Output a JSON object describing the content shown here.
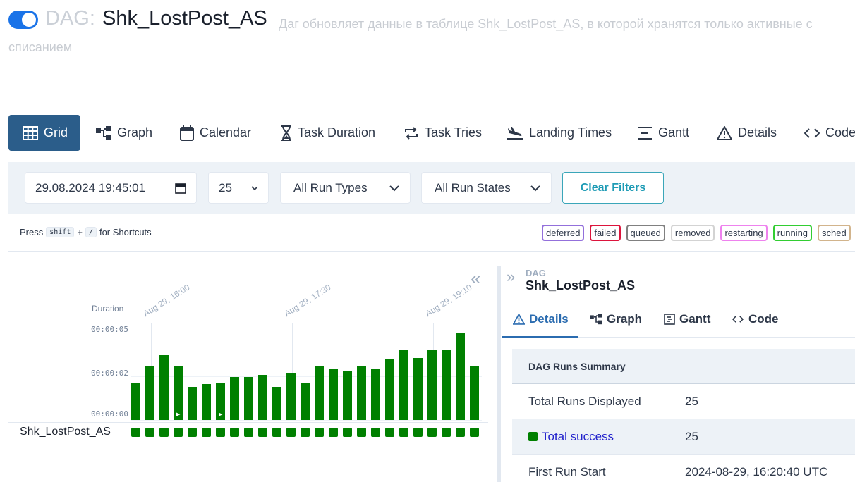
{
  "header": {
    "dag_prefix": "DAG:",
    "dag_name": "Shk_LostPost_AS",
    "description": "Даг обновляет данные в таблице Shk_LostPost_AS, в которой хранятся только активные с списанием",
    "toggle_on": true
  },
  "tabs": [
    {
      "label": "Grid",
      "icon": "grid-icon",
      "active": true
    },
    {
      "label": "Graph",
      "icon": "graph-icon"
    },
    {
      "label": "Calendar",
      "icon": "calendar-icon"
    },
    {
      "label": "Task Duration",
      "icon": "hourglass-icon"
    },
    {
      "label": "Task Tries",
      "icon": "repeat-icon"
    },
    {
      "label": "Landing Times",
      "icon": "plane-landing-icon"
    },
    {
      "label": "Gantt",
      "icon": "gantt-icon"
    },
    {
      "label": "Details",
      "icon": "warning-triangle-icon"
    },
    {
      "label": "Code",
      "icon": "code-icon"
    }
  ],
  "filters": {
    "datetime": "29.08.2024 19:45:01",
    "num_runs": "25",
    "run_types": "All Run Types",
    "run_states": "All Run States",
    "clear_label": "Clear Filters"
  },
  "shortcut": {
    "press": "Press",
    "key1": "shift",
    "plus": "+",
    "key2": "/",
    "suffix": "for Shortcuts"
  },
  "legend": [
    {
      "label": "deferred",
      "color": "#9370db"
    },
    {
      "label": "failed",
      "color": "#dc143c"
    },
    {
      "label": "queued",
      "color": "#808080"
    },
    {
      "label": "removed",
      "color": "#d3d3d3"
    },
    {
      "label": "restarting",
      "color": "#ee82ee"
    },
    {
      "label": "running",
      "color": "#32cd32"
    },
    {
      "label": "sched",
      "color": "#d2b48c"
    }
  ],
  "grid": {
    "duration_label": "Duration",
    "y_ticks": [
      "00:00:05",
      "00:00:02",
      "00:00:00"
    ],
    "date_labels": [
      "Aug 29, 16:00",
      "Aug 29, 17:30",
      "Aug 29, 19:10"
    ],
    "task_name": "Shk_LostPost_AS",
    "success_color": "#008000"
  },
  "chart_data": {
    "type": "bar",
    "title": "",
    "xlabel": "",
    "ylabel": "Duration",
    "ylim_seconds": [
      0,
      6
    ],
    "values_seconds": [
      2.1,
      3.1,
      3.7,
      3.1,
      1.9,
      2.05,
      2.1,
      2.45,
      2.45,
      2.6,
      1.9,
      2.7,
      2.1,
      3.1,
      2.95,
      2.8,
      3.1,
      2.95,
      3.45,
      4.0,
      3.55,
      4.0,
      4.0,
      5.0,
      3.1
    ],
    "run_types_marked": [
      8,
      11
    ],
    "run_count": 25
  },
  "right_panel": {
    "dag_small": "DAG",
    "dag_name": "Shk_LostPost_AS",
    "tabs": [
      {
        "label": "Details",
        "icon": "warning-triangle-icon",
        "active": true
      },
      {
        "label": "Graph",
        "icon": "graph-icon"
      },
      {
        "label": "Gantt",
        "icon": "gantt-icon"
      },
      {
        "label": "Code",
        "icon": "code-icon"
      }
    ],
    "summary_title": "DAG Runs Summary",
    "rows": [
      {
        "key": "Total Runs Displayed",
        "value": "25"
      },
      {
        "key": "Total success",
        "value": "25"
      },
      {
        "key": "First Run Start",
        "value": "2024-08-29, 16:20:40 UTC"
      }
    ]
  }
}
